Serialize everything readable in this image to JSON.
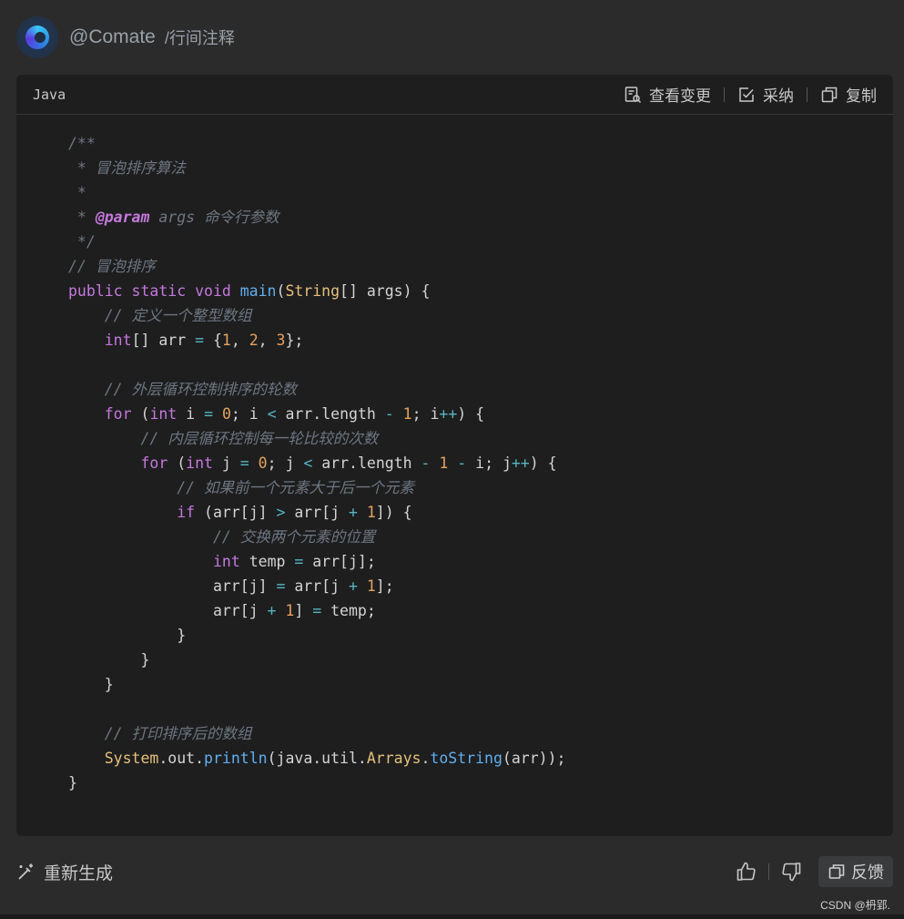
{
  "header": {
    "handle": "@Comate",
    "command": "/行间注释"
  },
  "code_block": {
    "language": "Java",
    "actions": {
      "view_changes": "查看变更",
      "accept": "采纳",
      "copy": "复制"
    },
    "lines": [
      [
        {
          "t": "/**",
          "c": "cm"
        }
      ],
      [
        {
          "t": " * 冒泡排序算法",
          "c": "cm"
        }
      ],
      [
        {
          "t": " *",
          "c": "cm"
        }
      ],
      [
        {
          "t": " * ",
          "c": "cm"
        },
        {
          "t": "@param",
          "c": "doc"
        },
        {
          "t": " args 命令行参数",
          "c": "cm"
        }
      ],
      [
        {
          "t": " */",
          "c": "cm"
        }
      ],
      [
        {
          "t": "// 冒泡排序",
          "c": "cm"
        }
      ],
      [
        {
          "t": "public static void ",
          "c": "kw"
        },
        {
          "t": "main",
          "c": "fn"
        },
        {
          "t": "(",
          "c": ""
        },
        {
          "t": "String",
          "c": "ty"
        },
        {
          "t": "[] args) {",
          "c": ""
        }
      ],
      [
        {
          "t": "    // 定义一个整型数组",
          "c": "cm"
        }
      ],
      [
        {
          "t": "    ",
          "c": ""
        },
        {
          "t": "int",
          "c": "kw"
        },
        {
          "t": "[] arr ",
          "c": ""
        },
        {
          "t": "=",
          "c": "op"
        },
        {
          "t": " {",
          "c": ""
        },
        {
          "t": "1",
          "c": "num"
        },
        {
          "t": ", ",
          "c": ""
        },
        {
          "t": "2",
          "c": "num"
        },
        {
          "t": ", ",
          "c": ""
        },
        {
          "t": "3",
          "c": "num"
        },
        {
          "t": "};",
          "c": ""
        }
      ],
      [
        {
          "t": "",
          "c": ""
        }
      ],
      [
        {
          "t": "    // 外层循环控制排序的轮数",
          "c": "cm"
        }
      ],
      [
        {
          "t": "    ",
          "c": ""
        },
        {
          "t": "for",
          "c": "kw"
        },
        {
          "t": " (",
          "c": ""
        },
        {
          "t": "int",
          "c": "kw"
        },
        {
          "t": " i ",
          "c": ""
        },
        {
          "t": "=",
          "c": "op"
        },
        {
          "t": " ",
          "c": ""
        },
        {
          "t": "0",
          "c": "num"
        },
        {
          "t": "; i ",
          "c": ""
        },
        {
          "t": "<",
          "c": "op"
        },
        {
          "t": " arr.length ",
          "c": ""
        },
        {
          "t": "-",
          "c": "op"
        },
        {
          "t": " ",
          "c": ""
        },
        {
          "t": "1",
          "c": "num"
        },
        {
          "t": "; i",
          "c": ""
        },
        {
          "t": "++",
          "c": "op"
        },
        {
          "t": ") {",
          "c": ""
        }
      ],
      [
        {
          "t": "        // 内层循环控制每一轮比较的次数",
          "c": "cm"
        }
      ],
      [
        {
          "t": "        ",
          "c": ""
        },
        {
          "t": "for",
          "c": "kw"
        },
        {
          "t": " (",
          "c": ""
        },
        {
          "t": "int",
          "c": "kw"
        },
        {
          "t": " j ",
          "c": ""
        },
        {
          "t": "=",
          "c": "op"
        },
        {
          "t": " ",
          "c": ""
        },
        {
          "t": "0",
          "c": "num"
        },
        {
          "t": "; j ",
          "c": ""
        },
        {
          "t": "<",
          "c": "op"
        },
        {
          "t": " arr.length ",
          "c": ""
        },
        {
          "t": "-",
          "c": "op"
        },
        {
          "t": " ",
          "c": ""
        },
        {
          "t": "1",
          "c": "num"
        },
        {
          "t": " ",
          "c": ""
        },
        {
          "t": "-",
          "c": "op"
        },
        {
          "t": " i; j",
          "c": ""
        },
        {
          "t": "++",
          "c": "op"
        },
        {
          "t": ") {",
          "c": ""
        }
      ],
      [
        {
          "t": "            // 如果前一个元素大于后一个元素",
          "c": "cm"
        }
      ],
      [
        {
          "t": "            ",
          "c": ""
        },
        {
          "t": "if",
          "c": "kw"
        },
        {
          "t": " (arr[j] ",
          "c": ""
        },
        {
          "t": ">",
          "c": "op"
        },
        {
          "t": " arr[j ",
          "c": ""
        },
        {
          "t": "+",
          "c": "op"
        },
        {
          "t": " ",
          "c": ""
        },
        {
          "t": "1",
          "c": "num"
        },
        {
          "t": "]) {",
          "c": ""
        }
      ],
      [
        {
          "t": "                // 交换两个元素的位置",
          "c": "cm"
        }
      ],
      [
        {
          "t": "                ",
          "c": ""
        },
        {
          "t": "int",
          "c": "kw"
        },
        {
          "t": " temp ",
          "c": ""
        },
        {
          "t": "=",
          "c": "op"
        },
        {
          "t": " arr[j];",
          "c": ""
        }
      ],
      [
        {
          "t": "                arr[j] ",
          "c": ""
        },
        {
          "t": "=",
          "c": "op"
        },
        {
          "t": " arr[j ",
          "c": ""
        },
        {
          "t": "+",
          "c": "op"
        },
        {
          "t": " ",
          "c": ""
        },
        {
          "t": "1",
          "c": "num"
        },
        {
          "t": "];",
          "c": ""
        }
      ],
      [
        {
          "t": "                arr[j ",
          "c": ""
        },
        {
          "t": "+",
          "c": "op"
        },
        {
          "t": " ",
          "c": ""
        },
        {
          "t": "1",
          "c": "num"
        },
        {
          "t": "] ",
          "c": ""
        },
        {
          "t": "=",
          "c": "op"
        },
        {
          "t": " temp;",
          "c": ""
        }
      ],
      [
        {
          "t": "            }",
          "c": ""
        }
      ],
      [
        {
          "t": "        }",
          "c": ""
        }
      ],
      [
        {
          "t": "    }",
          "c": ""
        }
      ],
      [
        {
          "t": "",
          "c": ""
        }
      ],
      [
        {
          "t": "    // 打印排序后的数组",
          "c": "cm"
        }
      ],
      [
        {
          "t": "    ",
          "c": ""
        },
        {
          "t": "System",
          "c": "ty"
        },
        {
          "t": ".out.",
          "c": ""
        },
        {
          "t": "println",
          "c": "fn"
        },
        {
          "t": "(java.util.",
          "c": ""
        },
        {
          "t": "Arrays",
          "c": "ty"
        },
        {
          "t": ".",
          "c": ""
        },
        {
          "t": "toString",
          "c": "fn"
        },
        {
          "t": "(arr));",
          "c": ""
        }
      ],
      [
        {
          "t": "}",
          "c": ""
        }
      ]
    ]
  },
  "footer": {
    "regenerate": "重新生成",
    "feedback": "反馈",
    "watermark": "CSDN @枬郢."
  },
  "icons": {
    "avatar": "comate-logo-icon",
    "view_changes": "diff-document-icon",
    "accept": "checkbox-icon",
    "copy": "copy-icon",
    "regenerate": "magic-wand-icon",
    "like": "thumbs-up-icon",
    "dislike": "thumbs-down-icon",
    "feedback": "feedback-icon"
  },
  "colors": {
    "background": "#2b2b2c",
    "card": "#1e1e1f",
    "comment": "#6e7681",
    "keyword": "#c678dd",
    "type": "#e5c07b",
    "function": "#61afef",
    "number": "#e5a35c",
    "operator": "#56b6c2"
  }
}
